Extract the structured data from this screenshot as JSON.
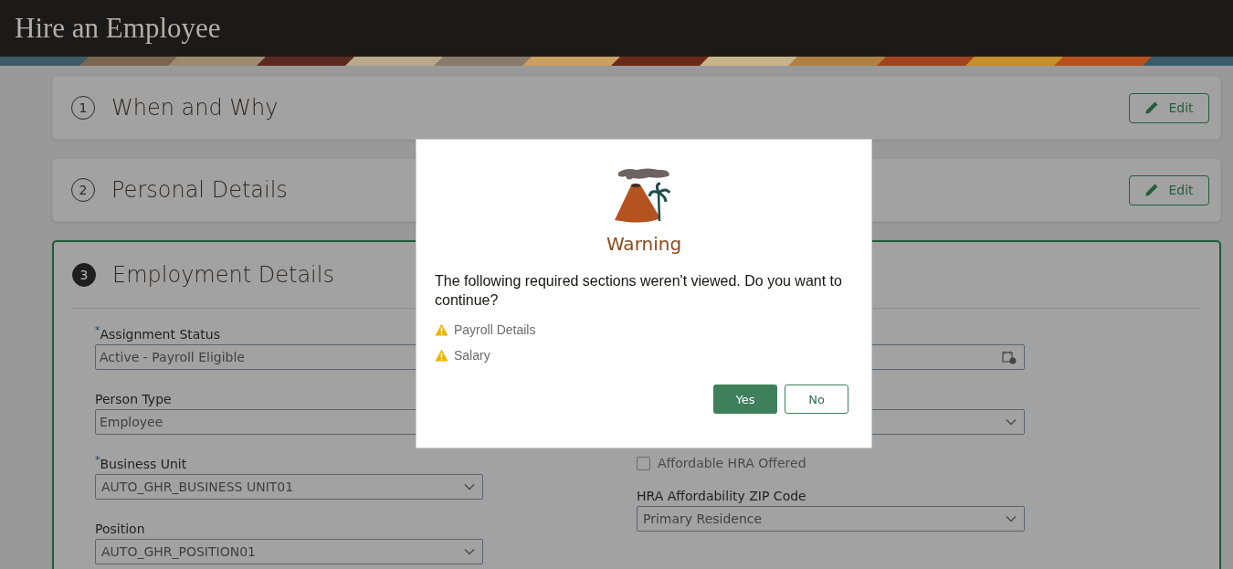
{
  "header": {
    "title": "Hire an Employee"
  },
  "steps": [
    {
      "number": "1",
      "title": "When and Why",
      "active": false,
      "edit_label": "Edit"
    },
    {
      "number": "2",
      "title": "Personal Details",
      "active": false,
      "edit_label": "Edit"
    },
    {
      "number": "3",
      "title": "Employment Details",
      "active": true
    }
  ],
  "left_fields": [
    {
      "kind": "text",
      "label": "Assignment Status",
      "required_mark": "*",
      "value": "Active - Payroll Eligible"
    },
    {
      "kind": "text",
      "label": "Person Type",
      "value": "Employee"
    },
    {
      "kind": "select",
      "label": "Business Unit",
      "required_mark": "*",
      "value": "AUTO_GHR_BUSINESS UNIT01"
    },
    {
      "kind": "select",
      "label": "Position",
      "value": "AUTO_GHR_POSITION01"
    }
  ],
  "right_fields": [
    {
      "kind": "date"
    },
    {
      "kind": "select"
    },
    {
      "kind": "checkbox",
      "label": "Affordable HRA Offered",
      "checked": false
    },
    {
      "kind": "select",
      "label": "HRA Affordability ZIP Code",
      "value": "Primary Residence"
    }
  ],
  "dialog": {
    "title": "Warning",
    "message": "The following required sections weren't viewed. Do you want to continue?",
    "items": [
      "Payroll Details",
      "Salary"
    ],
    "buttons": [
      {
        "label": "Yes",
        "kind": "primary"
      },
      {
        "label": "No",
        "kind": "secondary"
      }
    ]
  }
}
